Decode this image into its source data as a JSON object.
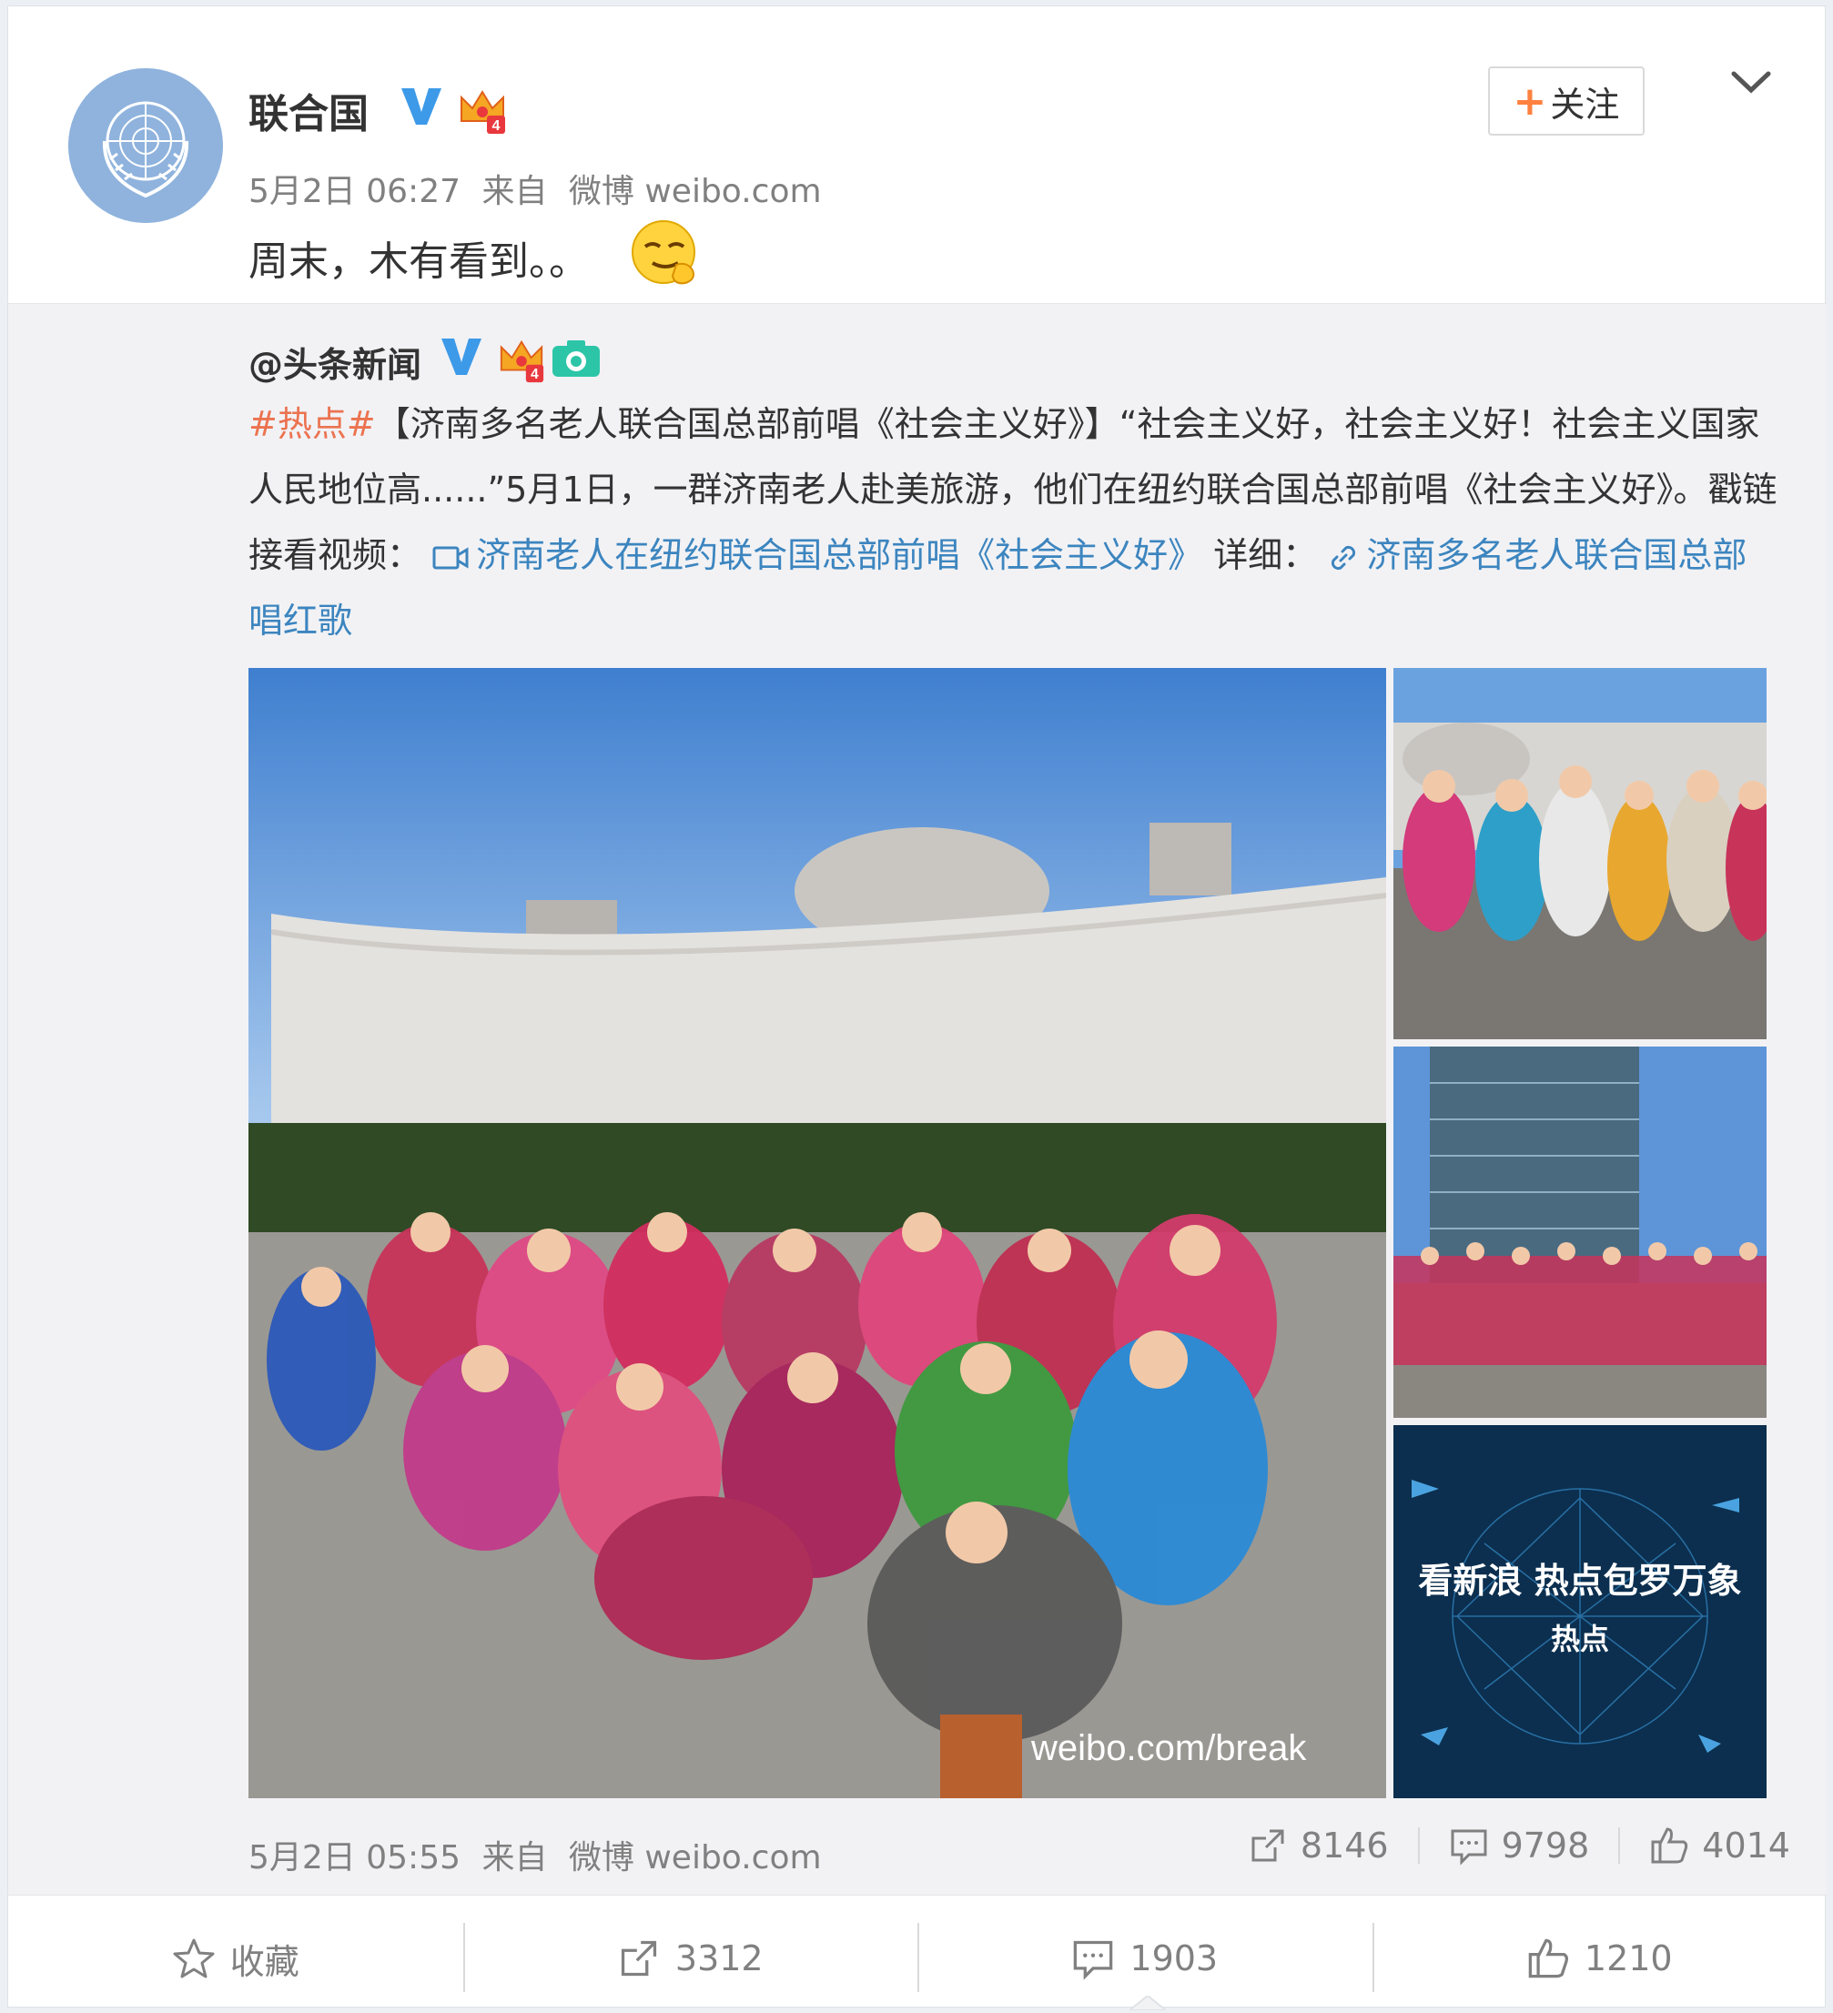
{
  "post": {
    "username": "联合国",
    "time": "5月2日 06:27",
    "source_prefix": "来自",
    "source": "微博 weibo.com",
    "text": "周末，木有看到。。",
    "follow_label": "关注"
  },
  "repost": {
    "username": "@头条新闻",
    "hashtag": "#热点#",
    "text_part1": "【济南多名老人联合国总部前唱《社会主义好》】“社会主义好，社会主义好！社会主义国家人民地位高......”5月1日，一群济南老人赴美旅游，他们在纽约联合国总部前唱《社会主义好》。戳链接看视频：",
    "video_link": "济南老人在纽约联合国总部前唱《社会主义好》",
    "detail_label": " 详细：",
    "detail_link": "济南多名老人联合国总部唱红歌",
    "time": "5月2日 05:55",
    "source_prefix": "来自",
    "source": "微博 weibo.com",
    "reposts": "8146",
    "comments": "9798",
    "likes": "4014",
    "banner_title": "看新浪 热点包罗万象",
    "banner_sub": "热点",
    "watermark": "weibo.com/break"
  },
  "actions": {
    "favorite": "收藏",
    "reposts": "3312",
    "comments": "1903",
    "likes": "1210"
  },
  "colors": {
    "link_orange": "#eb7350",
    "link_blue": "#3c85bf",
    "verified_blue": "#3d9ae8",
    "follow_plus": "#ff8140"
  },
  "icons": [
    "un-emblem",
    "verified-icon",
    "crown-icon",
    "camera-icon",
    "emoji-icon",
    "video-icon",
    "link-icon",
    "chevron-down-icon",
    "repost-icon",
    "comment-icon",
    "like-icon",
    "star-icon"
  ]
}
